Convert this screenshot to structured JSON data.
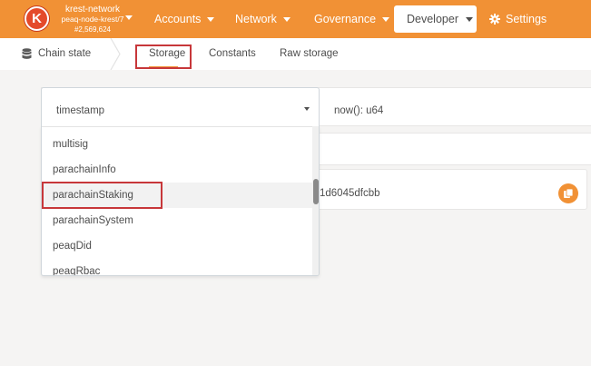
{
  "header": {
    "logo_letter": "K",
    "chain_name": "krest-network",
    "node_name": "peaq-node-krest/7",
    "block_number": "#2,569,624",
    "nav": {
      "accounts": "Accounts",
      "network": "Network",
      "governance": "Governance",
      "developer": "Developer",
      "settings": "Settings"
    }
  },
  "subnav": {
    "section": "Chain state",
    "tabs": {
      "storage": "Storage",
      "constants": "Constants",
      "raw_storage": "Raw storage"
    },
    "active_tab": "Storage"
  },
  "query": {
    "selected_module": "timestamp",
    "method_signature": "now(): u64",
    "result_hash_fragment": "1d6045dfcbb"
  },
  "dropdown": {
    "options": [
      "multisig",
      "parachainInfo",
      "parachainStaking",
      "parachainSystem",
      "peaqDid",
      "peaqRbac"
    ],
    "highlighted_index": 2
  },
  "colors": {
    "accent": "#f19135",
    "logo": "#e44a2b",
    "annotation_box": "#c7373a",
    "background": "#f5f4f3"
  },
  "icons": [
    "database-icon",
    "gear-icon",
    "copy-icon",
    "chevron-down-icon"
  ]
}
